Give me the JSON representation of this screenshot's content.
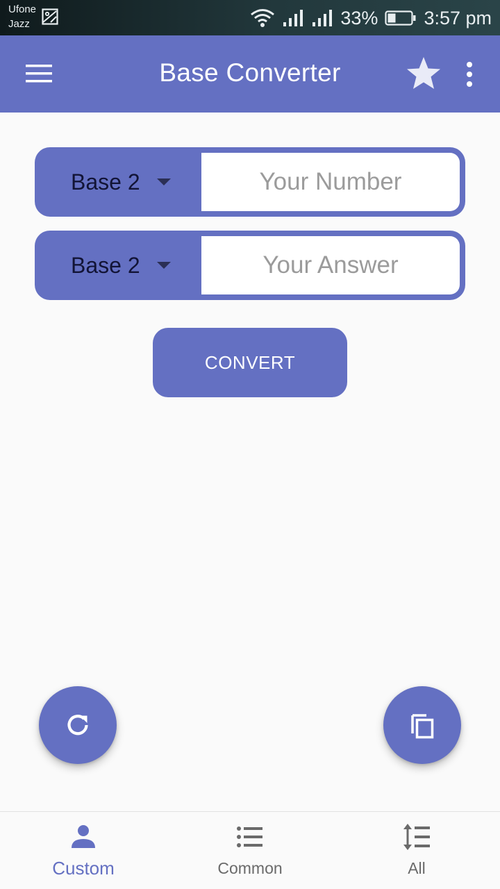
{
  "status_bar": {
    "carrier_1": "Ufone",
    "carrier_2": "Jazz",
    "battery": "33%",
    "time": "3:57 pm",
    "icons": [
      "gallery-icon",
      "wifi-icon",
      "signal-icon",
      "signal-icon",
      "battery-icon"
    ]
  },
  "app_bar": {
    "title": "Base Converter",
    "icons": [
      "menu-icon",
      "star-icon",
      "more-vert-icon"
    ]
  },
  "converter": {
    "from_base": "Base 2",
    "from_placeholder": "Your Number",
    "from_value": "",
    "to_base": "Base 2",
    "to_placeholder": "Your Answer",
    "to_value": "",
    "convert_label": "CONVERT"
  },
  "fabs": {
    "refresh_icon": "refresh-icon",
    "copy_icon": "copy-icon"
  },
  "bottom_nav": {
    "items": [
      {
        "label": "Custom",
        "icon": "person-icon",
        "active": true
      },
      {
        "label": "Common",
        "icon": "list-icon",
        "active": false
      },
      {
        "label": "All",
        "icon": "sort-icon",
        "active": false
      }
    ]
  },
  "colors": {
    "primary": "#6470c2",
    "background": "#fafafa",
    "inactive": "#6a6a6a"
  }
}
